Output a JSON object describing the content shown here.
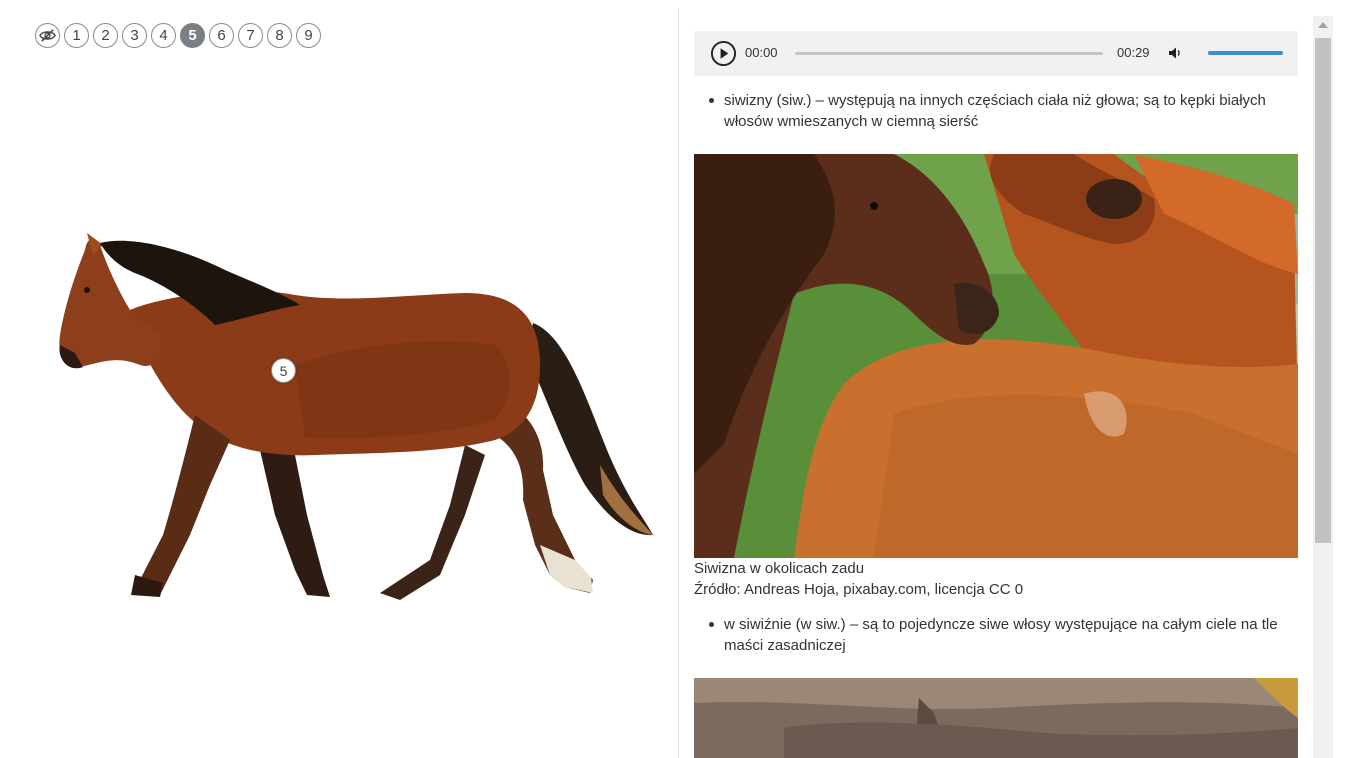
{
  "navigation": {
    "toggle_icon": "eye-slash-icon",
    "points": [
      "1",
      "2",
      "3",
      "4",
      "5",
      "6",
      "7",
      "8",
      "9"
    ],
    "active_point": "5"
  },
  "hotspot": {
    "label": "5"
  },
  "audio": {
    "play_icon": "play-icon",
    "current_time": "00:00",
    "total_time": "00:29",
    "progress_fraction": 0,
    "volume_icon": "volume-icon",
    "volume_fraction": 1.0,
    "accent_color": "#3a8fd2"
  },
  "content": {
    "bullet_1": "siwizny (siw.) – występują na innych częściach ciała niż głowa; są to kępki białych włosów wmieszanych w ciemną sierść",
    "caption_line_1": "Siwizna w okolicach zadu",
    "caption_line_2": "Źródło: Andreas Hoja, pixabay.com, licencja CC 0",
    "bullet_2": "w siwiźnie (w siw.) – są to pojedyncze siwe włosy występujące na całym ciele na tle maści zasadniczej"
  }
}
